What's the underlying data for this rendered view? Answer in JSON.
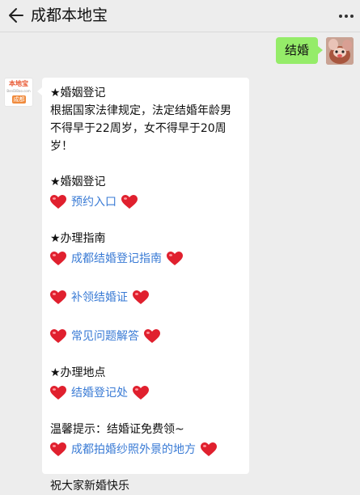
{
  "header": {
    "title": "成都本地宝",
    "back_icon": "back-arrow-icon",
    "more_icon": "more-dots-icon"
  },
  "outgoing": {
    "text": "结婚"
  },
  "bot_avatar": {
    "logo_text": "本地宝",
    "logo_sub": "BenDiBao.com",
    "badge": "成都"
  },
  "reply": {
    "section1_title": "★婚姻登记",
    "law_text": "根据国家法律规定，法定结婚年龄男不得早于22周岁，女不得早于20周岁！",
    "section2_title": "★婚姻登记",
    "link_booking": "预约入口",
    "section3_title": "★办理指南",
    "link_guide": "成都结婚登记指南",
    "link_reissue": "补领结婚证",
    "link_faq": "常见问题解答",
    "section4_title": "★办理地点",
    "link_office": "结婚登记处",
    "tip_text": "温馨提示：结婚证免费领~",
    "link_photo": "成都拍婚纱照外景的地方",
    "cut_text": "祝大家新婚快乐"
  },
  "colors": {
    "link": "#3a7bd5",
    "bubble_out": "#95ec69",
    "heart": "#e0202e",
    "background": "#ededed"
  }
}
